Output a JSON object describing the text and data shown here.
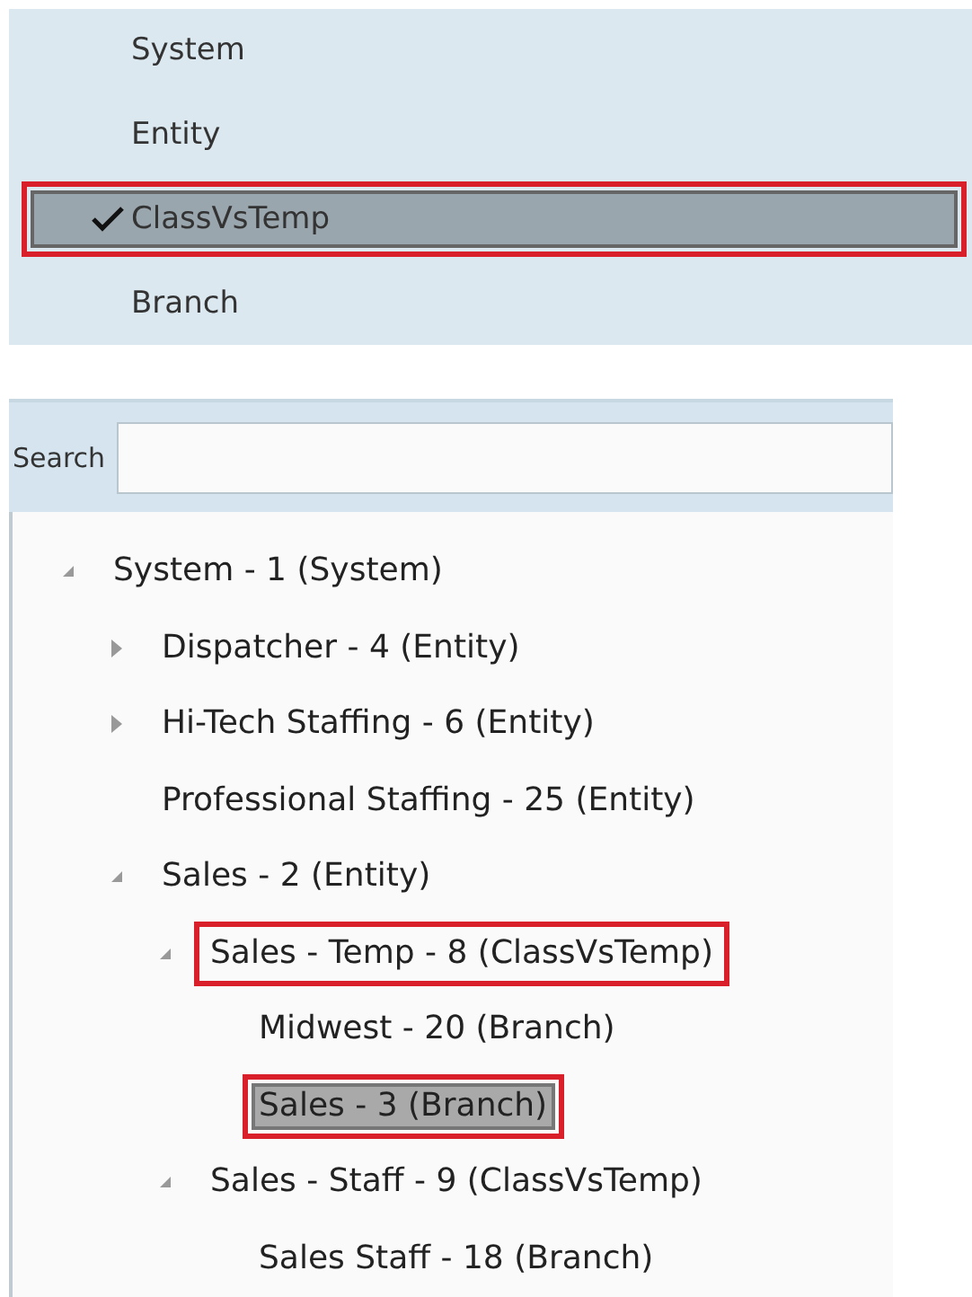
{
  "menu": {
    "items": [
      {
        "label": "System",
        "checked": false,
        "selected": false,
        "highlighted": false
      },
      {
        "label": "Entity",
        "checked": false,
        "selected": false,
        "highlighted": false
      },
      {
        "label": "ClassVsTemp",
        "checked": true,
        "selected": true,
        "highlighted": true
      },
      {
        "label": "Branch",
        "checked": false,
        "selected": false,
        "highlighted": false
      }
    ]
  },
  "search": {
    "label": "Search"
  },
  "tree": [
    {
      "label": "System - 1 (System)",
      "expanded": true,
      "selected": false,
      "highlighted": false,
      "children": [
        {
          "label": "Dispatcher - 4 (Entity)",
          "expanded": false,
          "selected": false,
          "highlighted": false
        },
        {
          "label": "Hi-Tech Staffing - 6 (Entity)",
          "expanded": false,
          "selected": false,
          "highlighted": false
        },
        {
          "label": "Professional Staffing - 25 (Entity)",
          "selected": false,
          "highlighted": false
        },
        {
          "label": "Sales - 2 (Entity)",
          "expanded": true,
          "selected": false,
          "highlighted": false,
          "children": [
            {
              "label": "Sales - Temp - 8 (ClassVsTemp)",
              "expanded": true,
              "selected": false,
              "highlighted": true,
              "children": [
                {
                  "label": "Midwest - 20 (Branch)",
                  "selected": false,
                  "highlighted": false
                },
                {
                  "label": "Sales - 3 (Branch)",
                  "selected": true,
                  "highlighted": true
                }
              ]
            },
            {
              "label": "Sales - Staff - 9 (ClassVsTemp)",
              "expanded": true,
              "selected": false,
              "highlighted": false,
              "children": [
                {
                  "label": "Sales Staff - 18 (Branch)",
                  "selected": false,
                  "highlighted": false
                }
              ]
            }
          ]
        }
      ]
    }
  ]
}
